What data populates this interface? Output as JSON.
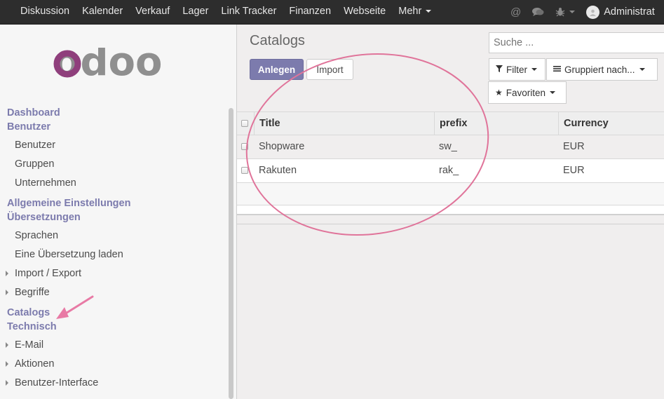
{
  "topnav": {
    "items": [
      "Diskussion",
      "Kalender",
      "Verkauf",
      "Lager",
      "Link Tracker",
      "Finanzen",
      "Webseite"
    ],
    "more_label": "Mehr",
    "user_name": "Administrat"
  },
  "sidebar": {
    "logo_text": "odoo",
    "heads": {
      "dashboard": "Dashboard",
      "benutzer": "Benutzer",
      "allgemeine": "Allgemeine Einstellungen",
      "uebersetzungen": "Übersetzungen",
      "catalogs": "Catalogs",
      "technisch": "Technisch"
    },
    "items": {
      "benutzer": "Benutzer",
      "gruppen": "Gruppen",
      "unternehmen": "Unternehmen",
      "sprachen": "Sprachen",
      "uebersetzung_laden": "Eine Übersetzung laden",
      "import_export": "Import / Export",
      "begriffe": "Begriffe",
      "email": "E-Mail",
      "aktionen": "Aktionen",
      "benutzer_interface": "Benutzer-Interface"
    }
  },
  "content": {
    "title": "Catalogs",
    "create_label": "Anlegen",
    "import_label": "Import",
    "search_placeholder": "Suche ...",
    "filter_label": "Filter",
    "group_label": "Gruppiert nach...",
    "favorites_label": "Favoriten"
  },
  "table": {
    "columns": [
      "Title",
      "prefix",
      "Currency"
    ],
    "rows": [
      [
        "Shopware",
        "sw_",
        "EUR"
      ],
      [
        "Rakuten",
        "rak_",
        "EUR"
      ]
    ]
  },
  "colors": {
    "navbar": "#2d2d2d",
    "accent": "#7c7bad",
    "annotation": "#e0749a",
    "logo_ring": "#8f3f7c",
    "logo_gray": "#8f8f8f"
  }
}
